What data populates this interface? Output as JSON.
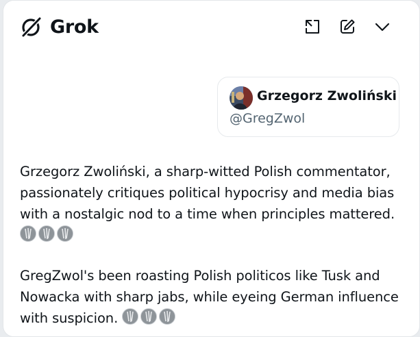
{
  "app": {
    "name": "Grok"
  },
  "header": {
    "actions": [
      {
        "icon": "expand-icon"
      },
      {
        "icon": "compose-icon"
      },
      {
        "icon": "chevron-down-icon"
      }
    ]
  },
  "user_card": {
    "display_name": "Grzegorz Zwoliński",
    "handle": "@GregZwol"
  },
  "response": {
    "paragraphs": [
      "Grzegorz Zwoliński, a sharp-witted Polish commentator, passionately critiques political hypocrisy and media bias with a nostalgic nod to a time when principles mattered.",
      "GregZwol's been roasting Polish politicos like Tusk and Nowacka with sharp jabs, while eyeing German influence with suspicion."
    ],
    "citation_counts": [
      3,
      3
    ]
  },
  "colors": {
    "text": "#0f1419",
    "muted": "#536471",
    "border": "#e6e9ec",
    "background": "#ffffff"
  }
}
